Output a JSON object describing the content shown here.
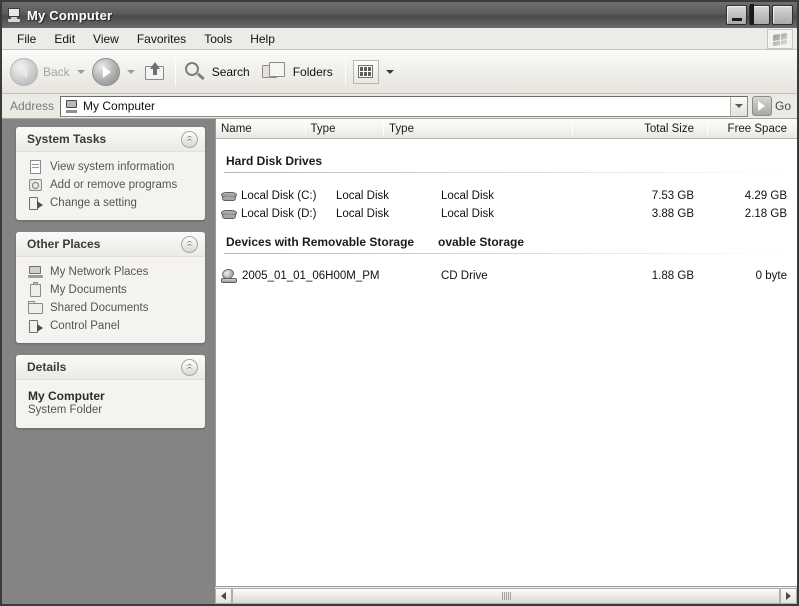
{
  "window": {
    "title": "My Computer",
    "icon": "computer-icon",
    "buttons": {
      "minimize": "minimize-button",
      "maximize": "maximize-button",
      "close": "close-button"
    }
  },
  "menubar": {
    "items": [
      "File",
      "Edit",
      "View",
      "Favorites",
      "Tools",
      "Help"
    ],
    "logo": "windows-flag-icon"
  },
  "toolbar": {
    "back_label": "Back",
    "back_enabled": false,
    "forward_label": "",
    "up_label": "",
    "search_label": "Search",
    "folders_label": "Folders",
    "views_label": ""
  },
  "address": {
    "label": "Address",
    "value": "My Computer",
    "go_label": "Go"
  },
  "sidebar": {
    "panels": [
      {
        "title": "System Tasks",
        "items": [
          {
            "label": "View system information",
            "icon": "document-icon"
          },
          {
            "label": "Add or remove programs",
            "icon": "add-remove-icon"
          },
          {
            "label": "Change a setting",
            "icon": "settings-icon"
          }
        ]
      },
      {
        "title": "Other Places",
        "items": [
          {
            "label": "My Network Places",
            "icon": "network-icon"
          },
          {
            "label": "My Documents",
            "icon": "documents-icon"
          },
          {
            "label": "Shared Documents",
            "icon": "folder-icon"
          },
          {
            "label": "Control Panel",
            "icon": "control-panel-icon"
          }
        ]
      },
      {
        "title": "Details",
        "detail_title": "My Computer",
        "detail_sub": "System Folder"
      }
    ]
  },
  "filelist": {
    "columns": [
      "Name",
      "Type",
      "Type",
      "Total Size",
      "Free Space"
    ],
    "groups": [
      {
        "header": "Hard Disk Drives",
        "artifact": "",
        "rows": [
          {
            "name": "Local Disk (C:)",
            "icon": "hard-disk-icon",
            "type1": "Local Disk",
            "type2": "Local Disk",
            "total_size": "7.53 GB",
            "free_space": "4.29 GB"
          },
          {
            "name": "Local Disk (D:)",
            "icon": "hard-disk-icon",
            "type1": "Local Disk",
            "type2": "Local Disk",
            "total_size": "3.88 GB",
            "free_space": "2.18 GB"
          }
        ]
      },
      {
        "header": "Devices with Removable Storage",
        "artifact": "ovable Storage",
        "rows": [
          {
            "name": "2005_01_01_06H00M_PM",
            "icon": "cd-drive-icon",
            "type1": "CD Drive",
            "type2": "",
            "total_size": "1.88 GB",
            "free_space": "0 byte"
          }
        ]
      }
    ]
  },
  "scrollbar": {
    "left_label": "scroll-left",
    "right_label": "scroll-right"
  }
}
